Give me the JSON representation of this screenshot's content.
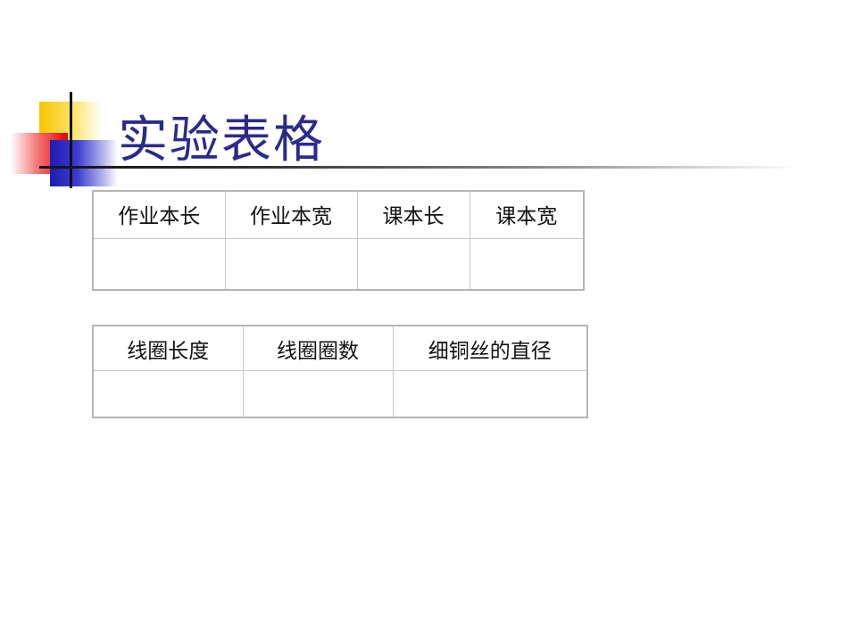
{
  "slide": {
    "title": "实验表格",
    "accent_colors": {
      "title": "#2b2b8c",
      "yellow": "#f7c600",
      "red": "#e60000",
      "blue": "#1c1cb4"
    }
  },
  "table1": {
    "headers": [
      "作业本长",
      "作业本宽",
      "课本长",
      "课本宽"
    ],
    "rows": [
      [
        "",
        "",
        "",
        ""
      ]
    ]
  },
  "table2": {
    "headers": [
      "线圈长度",
      "线圈圈数",
      "细铜丝的直径"
    ],
    "rows": [
      [
        "",
        "",
        ""
      ]
    ]
  }
}
